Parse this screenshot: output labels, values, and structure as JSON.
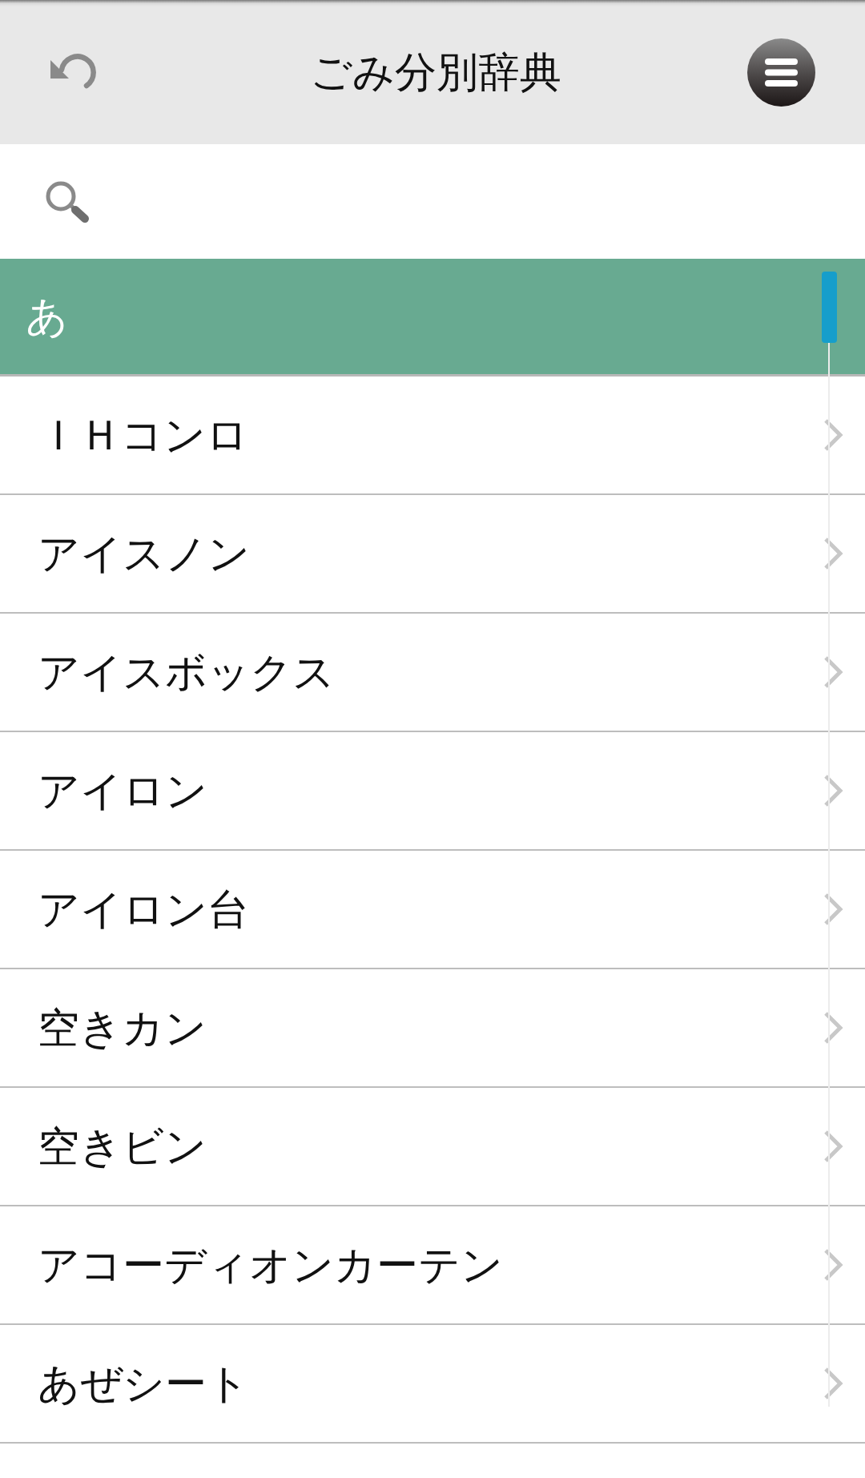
{
  "header": {
    "title": "ごみ分別辞典"
  },
  "section": {
    "heading": "あ",
    "items": [
      "ＩＨコンロ",
      "アイスノン",
      "アイスボックス",
      "アイロン",
      "アイロン台",
      "空きカン",
      "空きビン",
      "アコーディオンカーテン",
      "あぜシート"
    ]
  }
}
